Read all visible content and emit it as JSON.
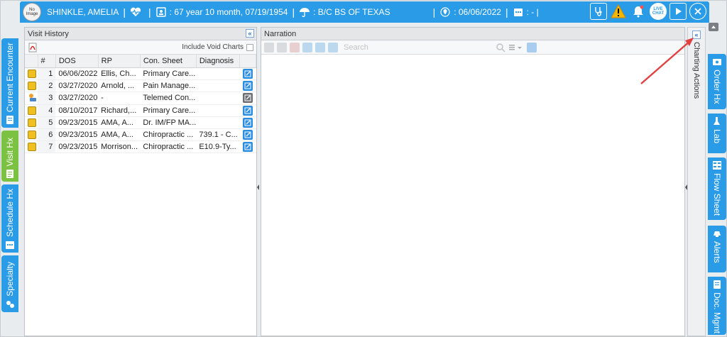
{
  "header": {
    "avatar_text_1": "No",
    "avatar_text_2": "Image",
    "patient_name": "SHINKLE, AMELIA",
    "sep1": "|",
    "sep2": "|",
    "age_dob": ": 67 year 10 month, 07/19/1954",
    "sep3": "|",
    "insurance": ": B/C BS OF TEXAS",
    "sep4": "|",
    "visit_date": ": 06/06/2022",
    "sep5": "|",
    "extra": ": -  |",
    "live_chat": "LIVE CHAT"
  },
  "left_tabs": [
    "Current Encounter",
    "Visit Hx",
    "Schedule Hx",
    "Specialty"
  ],
  "right_tabs": [
    "Order Hx",
    "Lab",
    "Flow Sheet",
    "Alerts",
    "Doc. Mgmt"
  ],
  "visit_history": {
    "title": "Visit History",
    "collapse": "«",
    "include_void": "Include Void Charts",
    "columns": [
      "#",
      "DOS",
      "RP",
      "Con. Sheet",
      "Diagnosis"
    ],
    "rows": [
      {
        "n": "1",
        "dos": "06/06/2022",
        "rp": "Ellis, Ch...",
        "con": "Primary Care...",
        "diag": "",
        "type": "doc",
        "edit": "blue"
      },
      {
        "n": "2",
        "dos": "03/27/2020",
        "rp": "Arnold, ...",
        "con": "Pain Manage...",
        "diag": "",
        "type": "doc",
        "edit": "blue"
      },
      {
        "n": "3",
        "dos": "03/27/2020",
        "rp": "-",
        "con": "Telemed Con...",
        "diag": "",
        "type": "tele",
        "edit": "gray"
      },
      {
        "n": "4",
        "dos": "08/10/2017",
        "rp": "Richard,...",
        "con": "Primary Care...",
        "diag": "",
        "type": "doc",
        "edit": "blue"
      },
      {
        "n": "5",
        "dos": "09/23/2015",
        "rp": "AMA, A...",
        "con": "Dr. IM/FP MA...",
        "diag": "",
        "type": "doc",
        "edit": "blue"
      },
      {
        "n": "6",
        "dos": "09/23/2015",
        "rp": "AMA, A...",
        "con": "Chiropractic ...",
        "diag": "739.1 - C...",
        "type": "doc",
        "edit": "blue"
      },
      {
        "n": "7",
        "dos": "09/23/2015",
        "rp": "Morrison...",
        "con": "Chiropractic ...",
        "diag": "E10.9-Ty...",
        "type": "doc",
        "edit": "blue"
      }
    ]
  },
  "narration": {
    "title": "Narration",
    "search_placeholder": "Search",
    "collapse": "«"
  },
  "charting_actions": "Charting Actions",
  "colors": {
    "header_blue": "#2a9be6",
    "active_tab_green": "#7cc242",
    "arrow_red": "#e04040"
  }
}
